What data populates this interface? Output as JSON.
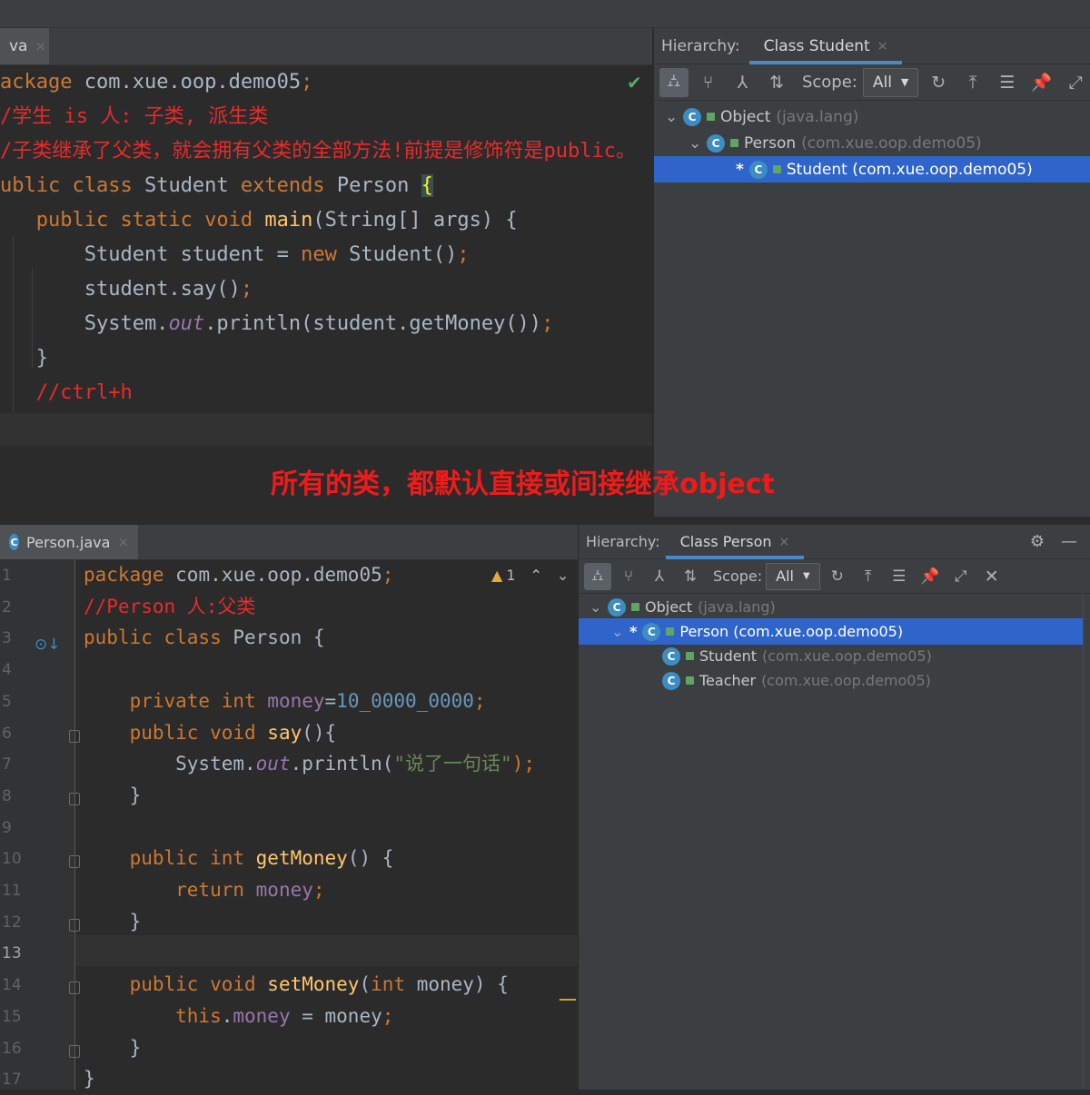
{
  "top_editor": {
    "tab_label": "va",
    "lines": [
      [
        {
          "t": "ackage ",
          "c": "kw"
        },
        {
          "t": "com.xue.oop.demo05",
          "c": "id"
        },
        {
          "t": ";",
          "c": "kw"
        }
      ],
      [
        {
          "t": "/学生 is 人: 子类, 派生类",
          "c": "cm"
        }
      ],
      [
        {
          "t": "/子类继承了父类，就会拥有父类的全部方法!前提是修饰符是public。",
          "c": "cm"
        }
      ],
      [
        {
          "t": "ublic class ",
          "c": "kw"
        },
        {
          "t": "Student ",
          "c": "id"
        },
        {
          "t": "extends ",
          "c": "kw"
        },
        {
          "t": "Person ",
          "c": "id"
        },
        {
          "t": "{",
          "c": "brace-hl"
        }
      ],
      [
        {
          "t": "   public static void ",
          "c": "kw"
        },
        {
          "t": "main",
          "c": "fn"
        },
        {
          "t": "(String[] args) {",
          "c": "id"
        }
      ],
      [
        {
          "t": "       Student student = ",
          "c": "id"
        },
        {
          "t": "new ",
          "c": "kw"
        },
        {
          "t": "Student()",
          "c": "id"
        },
        {
          "t": ";",
          "c": "kw"
        }
      ],
      [
        {
          "t": "       student.say()",
          "c": "id"
        },
        {
          "t": ";",
          "c": "kw"
        }
      ],
      [
        {
          "t": "       System.",
          "c": "id"
        },
        {
          "t": "out",
          "c": "it"
        },
        {
          "t": ".println(student.getMoney())",
          "c": "id"
        },
        {
          "t": ";",
          "c": "kw"
        }
      ],
      [
        {
          "t": "   }",
          "c": "id"
        }
      ],
      [
        {
          "t": "   //ctrl+h",
          "c": "cm"
        }
      ]
    ]
  },
  "top_hierarchy": {
    "label": "Hierarchy:",
    "tab_label": "Class Student",
    "scope_label": "Scope:",
    "scope_value": "All",
    "tree": [
      {
        "name": "Object",
        "pkg": "(java.lang)",
        "star": false,
        "selected": false
      },
      {
        "name": "Person",
        "pkg": "(com.xue.oop.demo05)",
        "star": false,
        "selected": false
      },
      {
        "name": "Student (com.xue.oop.demo05)",
        "pkg": "",
        "star": true,
        "selected": true
      }
    ]
  },
  "caption": "所有的类，都默认直接或间接继承object",
  "bottom_editor": {
    "tab_label": "Person.java",
    "warning_count": "1",
    "line_numbers": [
      "1",
      "2",
      "3",
      "4",
      "5",
      "6",
      "7",
      "8",
      "9",
      "10",
      "11",
      "12",
      "13",
      "14",
      "15",
      "16",
      "17"
    ],
    "lines": [
      [
        {
          "t": "package ",
          "c": "kw"
        },
        {
          "t": "com.xue.oop.demo05",
          "c": "id"
        },
        {
          "t": ";",
          "c": "kw"
        }
      ],
      [
        {
          "t": "//Person 人:父类",
          "c": "cm"
        }
      ],
      [
        {
          "t": "public class ",
          "c": "kw"
        },
        {
          "t": "Person {",
          "c": "id"
        }
      ],
      [],
      [
        {
          "t": "    private int ",
          "c": "kw"
        },
        {
          "t": "money",
          "c": "fld"
        },
        {
          "t": "=",
          "c": "id"
        },
        {
          "t": "10_0000_0000",
          "c": "num"
        },
        {
          "t": ";",
          "c": "kw"
        }
      ],
      [
        {
          "t": "    public void ",
          "c": "kw"
        },
        {
          "t": "say",
          "c": "fn"
        },
        {
          "t": "(){",
          "c": "id"
        }
      ],
      [
        {
          "t": "        System.",
          "c": "id"
        },
        {
          "t": "out",
          "c": "it"
        },
        {
          "t": ".println(",
          "c": "id"
        },
        {
          "t": "\"说了一句话\"",
          "c": "str"
        },
        {
          "t": ");",
          "c": "kw"
        }
      ],
      [
        {
          "t": "    }",
          "c": "id"
        }
      ],
      [],
      [
        {
          "t": "    public int ",
          "c": "kw"
        },
        {
          "t": "getMoney",
          "c": "fn"
        },
        {
          "t": "() {",
          "c": "id"
        }
      ],
      [
        {
          "t": "        return ",
          "c": "kw"
        },
        {
          "t": "money",
          "c": "fld"
        },
        {
          "t": ";",
          "c": "kw"
        }
      ],
      [
        {
          "t": "    }",
          "c": "id"
        }
      ],
      [],
      [
        {
          "t": "    public void ",
          "c": "kw"
        },
        {
          "t": "setMoney",
          "c": "fn"
        },
        {
          "t": "(",
          "c": "id"
        },
        {
          "t": "int ",
          "c": "kw"
        },
        {
          "t": "money) {",
          "c": "id"
        }
      ],
      [
        {
          "t": "        this",
          "c": "kw"
        },
        {
          "t": ".",
          "c": "id"
        },
        {
          "t": "money ",
          "c": "fld"
        },
        {
          "t": "= money",
          "c": "id"
        },
        {
          "t": ";",
          "c": "kw"
        }
      ],
      [
        {
          "t": "    }",
          "c": "id"
        }
      ],
      [
        {
          "t": "}",
          "c": "id"
        }
      ]
    ]
  },
  "bottom_hierarchy": {
    "label": "Hierarchy:",
    "tab_label": "Class Person",
    "scope_label": "Scope:",
    "scope_value": "All",
    "tree": [
      {
        "name": "Object",
        "pkg": "(java.lang)",
        "star": false,
        "selected": false
      },
      {
        "name": "Person (com.xue.oop.demo05)",
        "pkg": "",
        "star": true,
        "selected": true
      },
      {
        "name": "Student",
        "pkg": "(com.xue.oop.demo05)",
        "star": false,
        "selected": false
      },
      {
        "name": "Teacher",
        "pkg": "(com.xue.oop.demo05)",
        "star": false,
        "selected": false
      }
    ]
  },
  "colors": {
    "keyword": "#cc7832",
    "identifier": "#a9b7c6",
    "comment": "#e82b2b",
    "method": "#ffc66d",
    "field": "#9876aa",
    "string": "#6a8759",
    "number": "#6897bb",
    "selection": "#2f65ca",
    "caption": "#f01a1a"
  },
  "icons": [
    "check-icon",
    "class-icon",
    "expand-icon",
    "sort-icon",
    "refresh-icon",
    "gear-icon",
    "minimize-icon",
    "close-icon",
    "pin-icon",
    "warning-icon"
  ]
}
